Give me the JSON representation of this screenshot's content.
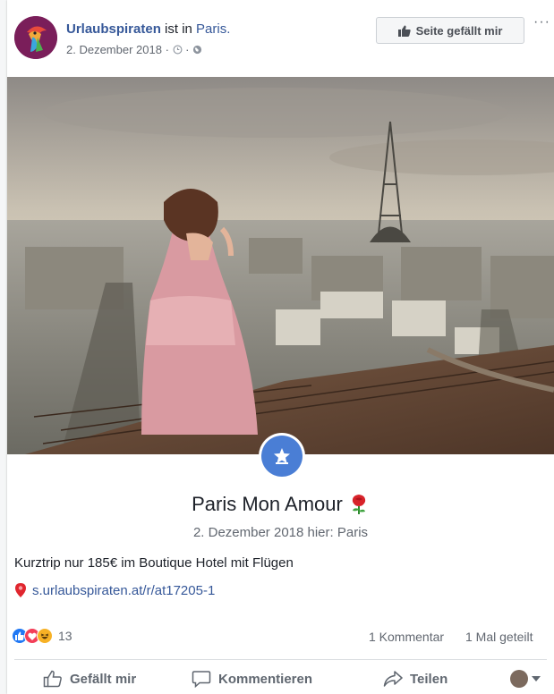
{
  "post": {
    "page_name": "Urlaubspiraten",
    "location_prefix": "ist in",
    "location": "Paris.",
    "date": "2. Dezember 2018 ·",
    "like_page_label": "Seite gefällt mir",
    "more_label": "···"
  },
  "event": {
    "title": "Paris Mon Amour",
    "subtitle": "2. Dezember 2018 hier: Paris"
  },
  "body": {
    "text": "Kurztrip nur 185€ im Boutique Hotel mit Flügen",
    "link": "s.urlaubspiraten.at/r/at17205-1"
  },
  "stats": {
    "reaction_count": "13",
    "comments": "1 Kommentar",
    "shares": "1 Mal geteilt"
  },
  "actions": {
    "like": "Gefällt mir",
    "comment": "Kommentieren",
    "share": "Teilen"
  },
  "colors": {
    "link_blue": "#365899",
    "event_blue": "#4a7ed5",
    "reaction_like": "#2078f4",
    "reaction_love": "#f33e58",
    "reaction_haha": "#f7b125"
  }
}
